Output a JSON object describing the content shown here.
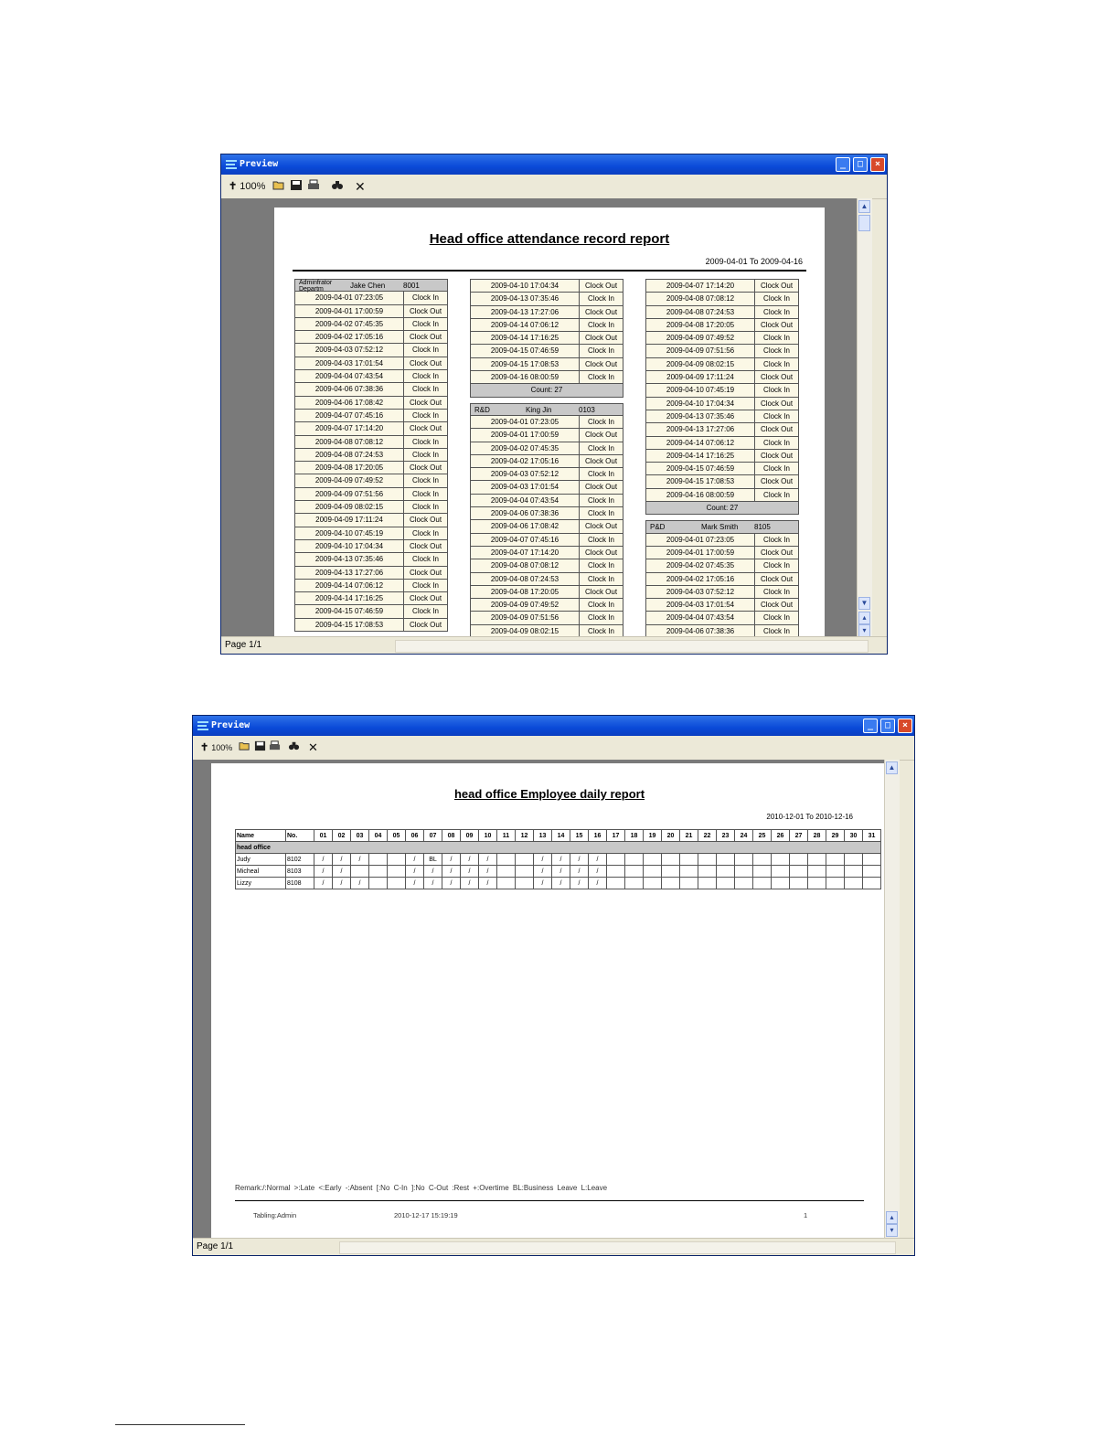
{
  "window1": {
    "title": "Preview",
    "zoom": "100%",
    "status": "Page 1/1",
    "report": {
      "title": "Head office attendance record report",
      "date_range": "2009-04-01 To 2009-04-16",
      "columns": [
        {
          "header": {
            "dept": "Adminfrator Departm",
            "name": "Jake Chen",
            "id": "8001"
          },
          "rows": [
            [
              "2009-04-01 07:23:05",
              "Clock In"
            ],
            [
              "2009-04-01 17:00:59",
              "Clock Out"
            ],
            [
              "2009-04-02 07:45:35",
              "Clock In"
            ],
            [
              "2009-04-02 17:05:16",
              "Clock Out"
            ],
            [
              "2009-04-03 07:52:12",
              "Clock In"
            ],
            [
              "2009-04-03 17:01:54",
              "Clock Out"
            ],
            [
              "2009-04-04 07:43:54",
              "Clock In"
            ],
            [
              "2009-04-06 07:38:36",
              "Clock In"
            ],
            [
              "2009-04-06 17:08:42",
              "Clock Out"
            ],
            [
              "2009-04-07 07:45:16",
              "Clock In"
            ],
            [
              "2009-04-07 17:14:20",
              "Clock Out"
            ],
            [
              "2009-04-08 07:08:12",
              "Clock In"
            ],
            [
              "2009-04-08 07:24:53",
              "Clock In"
            ],
            [
              "2009-04-08 17:20:05",
              "Clock Out"
            ],
            [
              "2009-04-09 07:49:52",
              "Clock In"
            ],
            [
              "2009-04-09 07:51:56",
              "Clock In"
            ],
            [
              "2009-04-09 08:02:15",
              "Clock In"
            ],
            [
              "2009-04-09 17:11:24",
              "Clock Out"
            ],
            [
              "2009-04-10 07:45:19",
              "Clock In"
            ],
            [
              "2009-04-10 17:04:34",
              "Clock Out"
            ],
            [
              "2009-04-13 07:35:46",
              "Clock In"
            ],
            [
              "2009-04-13 17:27:06",
              "Clock Out"
            ],
            [
              "2009-04-14 07:06:12",
              "Clock In"
            ],
            [
              "2009-04-14 17:16:25",
              "Clock Out"
            ],
            [
              "2009-04-15 07:46:59",
              "Clock In"
            ],
            [
              "2009-04-15 17:08:53",
              "Clock Out"
            ]
          ]
        },
        {
          "rows_top": [
            [
              "2009-04-10 17:04:34",
              "Clock Out"
            ],
            [
              "2009-04-13 07:35:46",
              "Clock In"
            ],
            [
              "2009-04-13 17:27:06",
              "Clock Out"
            ],
            [
              "2009-04-14 07:06:12",
              "Clock In"
            ],
            [
              "2009-04-14 17:16:25",
              "Clock Out"
            ],
            [
              "2009-04-15 07:46:59",
              "Clock In"
            ],
            [
              "2009-04-15 17:08:53",
              "Clock Out"
            ],
            [
              "2009-04-16 08:00:59",
              "Clock In"
            ]
          ],
          "count": "Count: 27",
          "header": {
            "dept": "R&D",
            "name": "King Jin",
            "id": "0103"
          },
          "rows": [
            [
              "2009-04-01 07:23:05",
              "Clock In"
            ],
            [
              "2009-04-01 17:00:59",
              "Clock Out"
            ],
            [
              "2009-04-02 07:45:35",
              "Clock In"
            ],
            [
              "2009-04-02 17:05:16",
              "Clock Out"
            ],
            [
              "2009-04-03 07:52:12",
              "Clock In"
            ],
            [
              "2009-04-03 17:01:54",
              "Clock Out"
            ],
            [
              "2009-04-04 07:43:54",
              "Clock In"
            ],
            [
              "2009-04-06 07:38:36",
              "Clock In"
            ],
            [
              "2009-04-06 17:08:42",
              "Clock Out"
            ],
            [
              "2009-04-07 07:45:16",
              "Clock In"
            ],
            [
              "2009-04-07 17:14:20",
              "Clock Out"
            ],
            [
              "2009-04-08 07:08:12",
              "Clock In"
            ],
            [
              "2009-04-08 07:24:53",
              "Clock In"
            ],
            [
              "2009-04-08 17:20:05",
              "Clock Out"
            ],
            [
              "2009-04-09 07:49:52",
              "Clock In"
            ],
            [
              "2009-04-09 07:51:56",
              "Clock In"
            ],
            [
              "2009-04-09 08:02:15",
              "Clock In"
            ]
          ]
        },
        {
          "rows_top": [
            [
              "2009-04-07 17:14:20",
              "Clock Out"
            ],
            [
              "2009-04-08 07:08:12",
              "Clock In"
            ],
            [
              "2009-04-08 07:24:53",
              "Clock In"
            ],
            [
              "2009-04-08 17:20:05",
              "Clock Out"
            ],
            [
              "2009-04-09 07:49:52",
              "Clock In"
            ],
            [
              "2009-04-09 07:51:56",
              "Clock In"
            ],
            [
              "2009-04-09 08:02:15",
              "Clock In"
            ],
            [
              "2009-04-09 17:11:24",
              "Clock Out"
            ],
            [
              "2009-04-10 07:45:19",
              "Clock In"
            ],
            [
              "2009-04-10 17:04:34",
              "Clock Out"
            ],
            [
              "2009-04-13 07:35:46",
              "Clock In"
            ],
            [
              "2009-04-13 17:27:06",
              "Clock Out"
            ],
            [
              "2009-04-14 07:06:12",
              "Clock In"
            ],
            [
              "2009-04-14 17:16:25",
              "Clock Out"
            ],
            [
              "2009-04-15 07:46:59",
              "Clock In"
            ],
            [
              "2009-04-15 17:08:53",
              "Clock Out"
            ],
            [
              "2009-04-16 08:00:59",
              "Clock In"
            ]
          ],
          "count": "Count: 27",
          "header": {
            "dept": "P&D",
            "name": "Mark Smith",
            "id": "8105"
          },
          "rows": [
            [
              "2009-04-01 07:23:05",
              "Clock In"
            ],
            [
              "2009-04-01 17:00:59",
              "Clock Out"
            ],
            [
              "2009-04-02 07:45:35",
              "Clock In"
            ],
            [
              "2009-04-02 17:05:16",
              "Clock Out"
            ],
            [
              "2009-04-03 07:52:12",
              "Clock In"
            ],
            [
              "2009-04-03 17:01:54",
              "Clock Out"
            ],
            [
              "2009-04-04 07:43:54",
              "Clock In"
            ],
            [
              "2009-04-06 07:38:36",
              "Clock In"
            ]
          ]
        }
      ]
    }
  },
  "window2": {
    "title": "Preview",
    "zoom": "100%",
    "status": "Page 1/1",
    "report": {
      "title": "head office Employee daily report",
      "date_range": "2010-12-01 To 2010-12-16",
      "col_name": "Name",
      "col_no": "No.",
      "days": [
        "01",
        "02",
        "03",
        "04",
        "05",
        "06",
        "07",
        "08",
        "09",
        "10",
        "11",
        "12",
        "13",
        "14",
        "15",
        "16",
        "17",
        "18",
        "19",
        "20",
        "21",
        "22",
        "23",
        "24",
        "25",
        "26",
        "27",
        "28",
        "29",
        "30",
        "31"
      ],
      "group": "head office",
      "employees": [
        {
          "name": "Judy",
          "no": "8102",
          "marks": [
            "/",
            "/",
            "/",
            "",
            "",
            "/",
            "BL",
            "/",
            "/",
            "/",
            "",
            "",
            "/",
            "/",
            "/",
            "/",
            "",
            "",
            "",
            "",
            "",
            "",
            "",
            "",
            "",
            "",
            "",
            "",
            "",
            "",
            ""
          ]
        },
        {
          "name": "Micheal",
          "no": "8103",
          "marks": [
            "/",
            "/",
            "",
            "",
            "",
            "/",
            "/",
            "/",
            "/",
            "/",
            "",
            "",
            "/",
            "/",
            "/",
            "/",
            "",
            "",
            "",
            "",
            "",
            "",
            "",
            "",
            "",
            "",
            "",
            "",
            "",
            "",
            ""
          ]
        },
        {
          "name": "Lizzy",
          "no": "8108",
          "marks": [
            "/",
            "/",
            "/",
            "",
            "",
            "/",
            "/",
            "/",
            "/",
            "/",
            "",
            "",
            "/",
            "/",
            "/",
            "/",
            "",
            "",
            "",
            "",
            "",
            "",
            "",
            "",
            "",
            "",
            "",
            "",
            "",
            "",
            ""
          ]
        }
      ],
      "remark": "Remark:/:Normal  >:Late  <:Early  -:Absent  [:No C-In  ]:No C-Out  :Rest  +:Overtime  BL:Business Leave  L:Leave",
      "footer": {
        "tabling": "Tabling:Admin",
        "timestamp": "2010-12-17 15:19:19",
        "page": "1"
      }
    }
  }
}
